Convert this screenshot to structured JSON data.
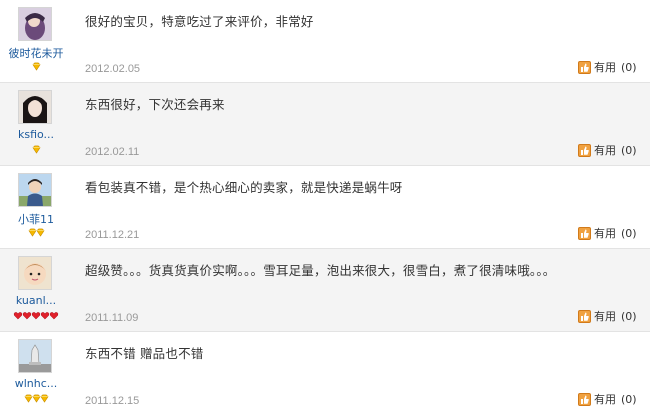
{
  "reviews": [
    {
      "username": "彼时花未开",
      "badge_type": "yellow",
      "badge_count": 1,
      "content": "很好的宝贝，特意吃过了来评价，非常好",
      "date": "2012.02.05",
      "useful_label": "有用",
      "useful_count": "(0)",
      "avatar_icon": "avatar-purple-icon"
    },
    {
      "username": "ksfio...",
      "badge_type": "yellow",
      "badge_count": 1,
      "content": "东西很好，下次还会再来",
      "date": "2012.02.11",
      "useful_label": "有用",
      "useful_count": "(0)",
      "avatar_icon": "avatar-dark-hair-icon"
    },
    {
      "username": "小菲11",
      "badge_type": "yellow",
      "badge_count": 2,
      "content": "看包装真不错，是个热心细心的卖家，就是快递是蜗牛呀",
      "date": "2011.12.21",
      "useful_label": "有用",
      "useful_count": "(0)",
      "avatar_icon": "avatar-outdoor-icon"
    },
    {
      "username": "kuanl...",
      "badge_type": "red",
      "badge_count": 5,
      "content": "超级赞。。。货真货真价实啊。。。雪耳足量，泡出来很大，很雪白，煮了很清味哦。。。",
      "date": "2011.11.09",
      "useful_label": "有用",
      "useful_count": "(0)",
      "avatar_icon": "avatar-baby-icon"
    },
    {
      "username": "wlnhc...",
      "badge_type": "yellow",
      "badge_count": 3,
      "content": "东西不错 赠品也不错",
      "date": "2011.12.15",
      "useful_label": "有用",
      "useful_count": "(0)",
      "avatar_icon": "avatar-monument-icon"
    }
  ],
  "colors": {
    "username": "#1c5a9c",
    "date": "#999999",
    "badge_yellow": "#f5b800",
    "badge_red": "#e0202a",
    "useful_icon": "#f0a140"
  }
}
